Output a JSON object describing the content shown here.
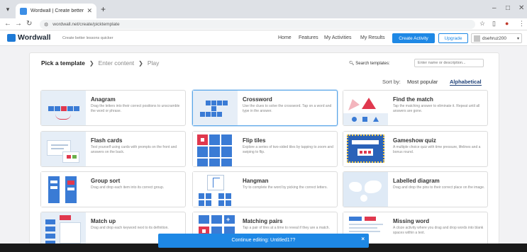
{
  "browser": {
    "tab_title": "Wordwall | Create better lesson",
    "url": "wordwall.net/create/picktemplate"
  },
  "header": {
    "logo_text": "Wordwall",
    "tagline": "Create better lessons quicker",
    "nav": [
      "Home",
      "Features",
      "My Activities",
      "My Results"
    ],
    "create_label": "Create Activity",
    "upgrade_label": "Upgrade",
    "username": "dsehruz200"
  },
  "main": {
    "crumbs": [
      "Pick a template",
      "Enter content",
      "Play"
    ],
    "search_label": "Search templates:",
    "search_placeholder": "Enter name or description...",
    "sort_label": "Sort by:",
    "sort_options": [
      "Most popular",
      "Alphabetical"
    ],
    "sort_selected": "Alphabetical",
    "templates": [
      {
        "name": "Anagram",
        "desc": "Drag the letters into their correct positions to unscramble the word or phrase."
      },
      {
        "name": "Crossword",
        "desc": "Use the clues to solve the crossword. Tap on a word and type in the answer."
      },
      {
        "name": "Find the match",
        "desc": "Tap the matching answer to eliminate it. Repeat until all answers are gone."
      },
      {
        "name": "Flash cards",
        "desc": "Test yourself using cards with prompts on the front and answers on the back."
      },
      {
        "name": "Flip tiles",
        "desc": "Explore a series of two-sided tiles by tapping to zoom and swiping to flip."
      },
      {
        "name": "Gameshow quiz",
        "desc": "A multiple choice quiz with time pressure, lifelines and a bonus round."
      },
      {
        "name": "Group sort",
        "desc": "Drag and drop each item into its correct group."
      },
      {
        "name": "Hangman",
        "desc": "Try to complete the word by picking the correct letters."
      },
      {
        "name": "Labelled diagram",
        "desc": "Drag and drop the pins to their correct place on the image."
      },
      {
        "name": "Match up",
        "desc": "Drag and drop each keyword next to its definition."
      },
      {
        "name": "Matching pairs",
        "desc": "Tap a pair of tiles at a time to reveal if they are a match."
      },
      {
        "name": "Missing word",
        "desc": "A cloze activity where you drag and drop words into blank spaces within a text."
      }
    ]
  },
  "toast": {
    "message": "Continue editing: Untitled17?",
    "close": "×"
  },
  "colors": {
    "accent": "#1e88e5",
    "dark_blue": "#1d3f77",
    "red": "#e0384e"
  }
}
